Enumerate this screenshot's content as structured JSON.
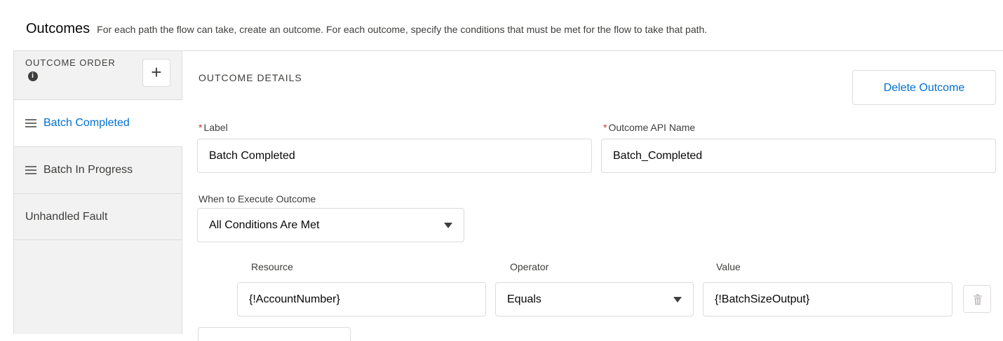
{
  "header": {
    "title": "Outcomes",
    "description": "For each path the flow can take, create an outcome. For each outcome, specify the conditions that must be met for the flow to take that path."
  },
  "sidebar": {
    "order_label": "OUTCOME ORDER",
    "info_icon": "info-icon",
    "add_label": "+",
    "items": [
      {
        "label": "Batch Completed",
        "active": true,
        "draggable": true
      },
      {
        "label": "Batch In Progress",
        "active": false,
        "draggable": true
      },
      {
        "label": "Unhandled Fault",
        "active": false,
        "draggable": false
      }
    ]
  },
  "details": {
    "section_title": "OUTCOME DETAILS",
    "delete_label": "Delete Outcome",
    "label_field": {
      "label": "Label",
      "required": true,
      "value": "Batch Completed"
    },
    "api_name_field": {
      "label": "Outcome API Name",
      "required": true,
      "value": "Batch_Completed"
    },
    "execute_field": {
      "label": "When to Execute Outcome",
      "value": "All Conditions Are Met"
    },
    "condition": {
      "resource_label": "Resource",
      "resource_value": "{!AccountNumber}",
      "operator_label": "Operator",
      "operator_value": "Equals",
      "value_label": "Value",
      "value_value": "{!BatchSizeOutput}"
    }
  },
  "colors": {
    "accent": "#0070d2",
    "required": "#c23934",
    "border": "#dddbda",
    "sidebar_bg": "#f3f2f2"
  }
}
